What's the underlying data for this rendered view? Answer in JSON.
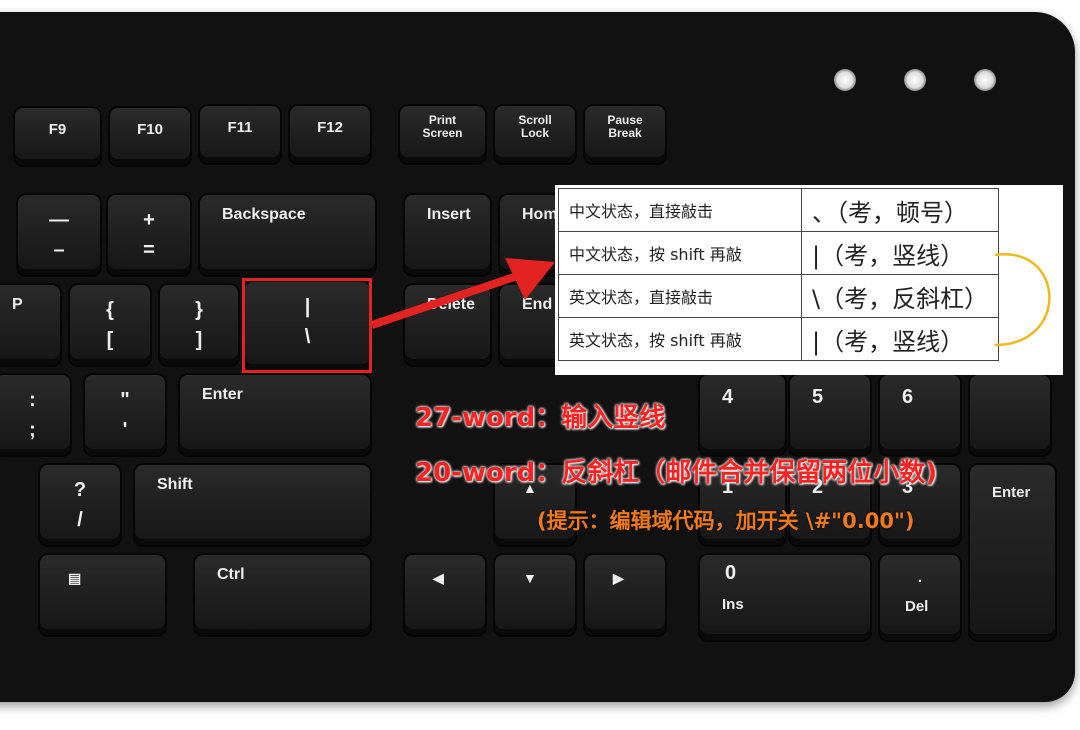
{
  "keys": {
    "f9": "F9",
    "f10": "F10",
    "f11": "F11",
    "f12": "F12",
    "print": "Print\nScreen",
    "scroll": "Scroll\nLock",
    "pause": "Pause\nBreak",
    "minus": "—\n–",
    "plus": "+\n=",
    "backspace": "Backspace",
    "insert": "Insert",
    "home": "Home",
    "p": "P",
    "bracel": "{\n[",
    "bracer": "}\n]",
    "pipe": "|\n\\",
    "delete": "Delete",
    "end": "End",
    "colon": ":\n;",
    "quote": "\"\n'",
    "enter": "Enter",
    "n4": "4",
    "n5": "5",
    "n6": "6",
    "question": "?\n/",
    "shift": "Shift",
    "n1": "1",
    "n2": "2",
    "n3": "3",
    "npenter": "Enter",
    "ctrl": "Ctrl",
    "n0": "0",
    "ins": "Ins",
    "dot": ".",
    "del": "Del"
  },
  "table": {
    "rows": [
      {
        "state": "中文状态，直接敲击",
        "result": "、（考，顿号）"
      },
      {
        "state": "中文状态，按 shift 再敲",
        "result": "|（考，竖线）"
      },
      {
        "state": "英文状态，直接敲击",
        "result": "\\（考，反斜杠）"
      },
      {
        "state": "英文状态，按 shift 再敲",
        "result": "|（考，竖线）"
      }
    ]
  },
  "annotations": {
    "line1": "27-word：输入竖线",
    "line2": "20-word：反斜杠（邮件合并保留两位小数)",
    "line3": "(提示：编辑域代码，加开关 \\#\"0.00\")"
  },
  "colors": {
    "highlight": "#e32222",
    "connector": "#f0b820",
    "annotation_red": "#ff2222",
    "annotation_orange": "#f07a1a"
  }
}
